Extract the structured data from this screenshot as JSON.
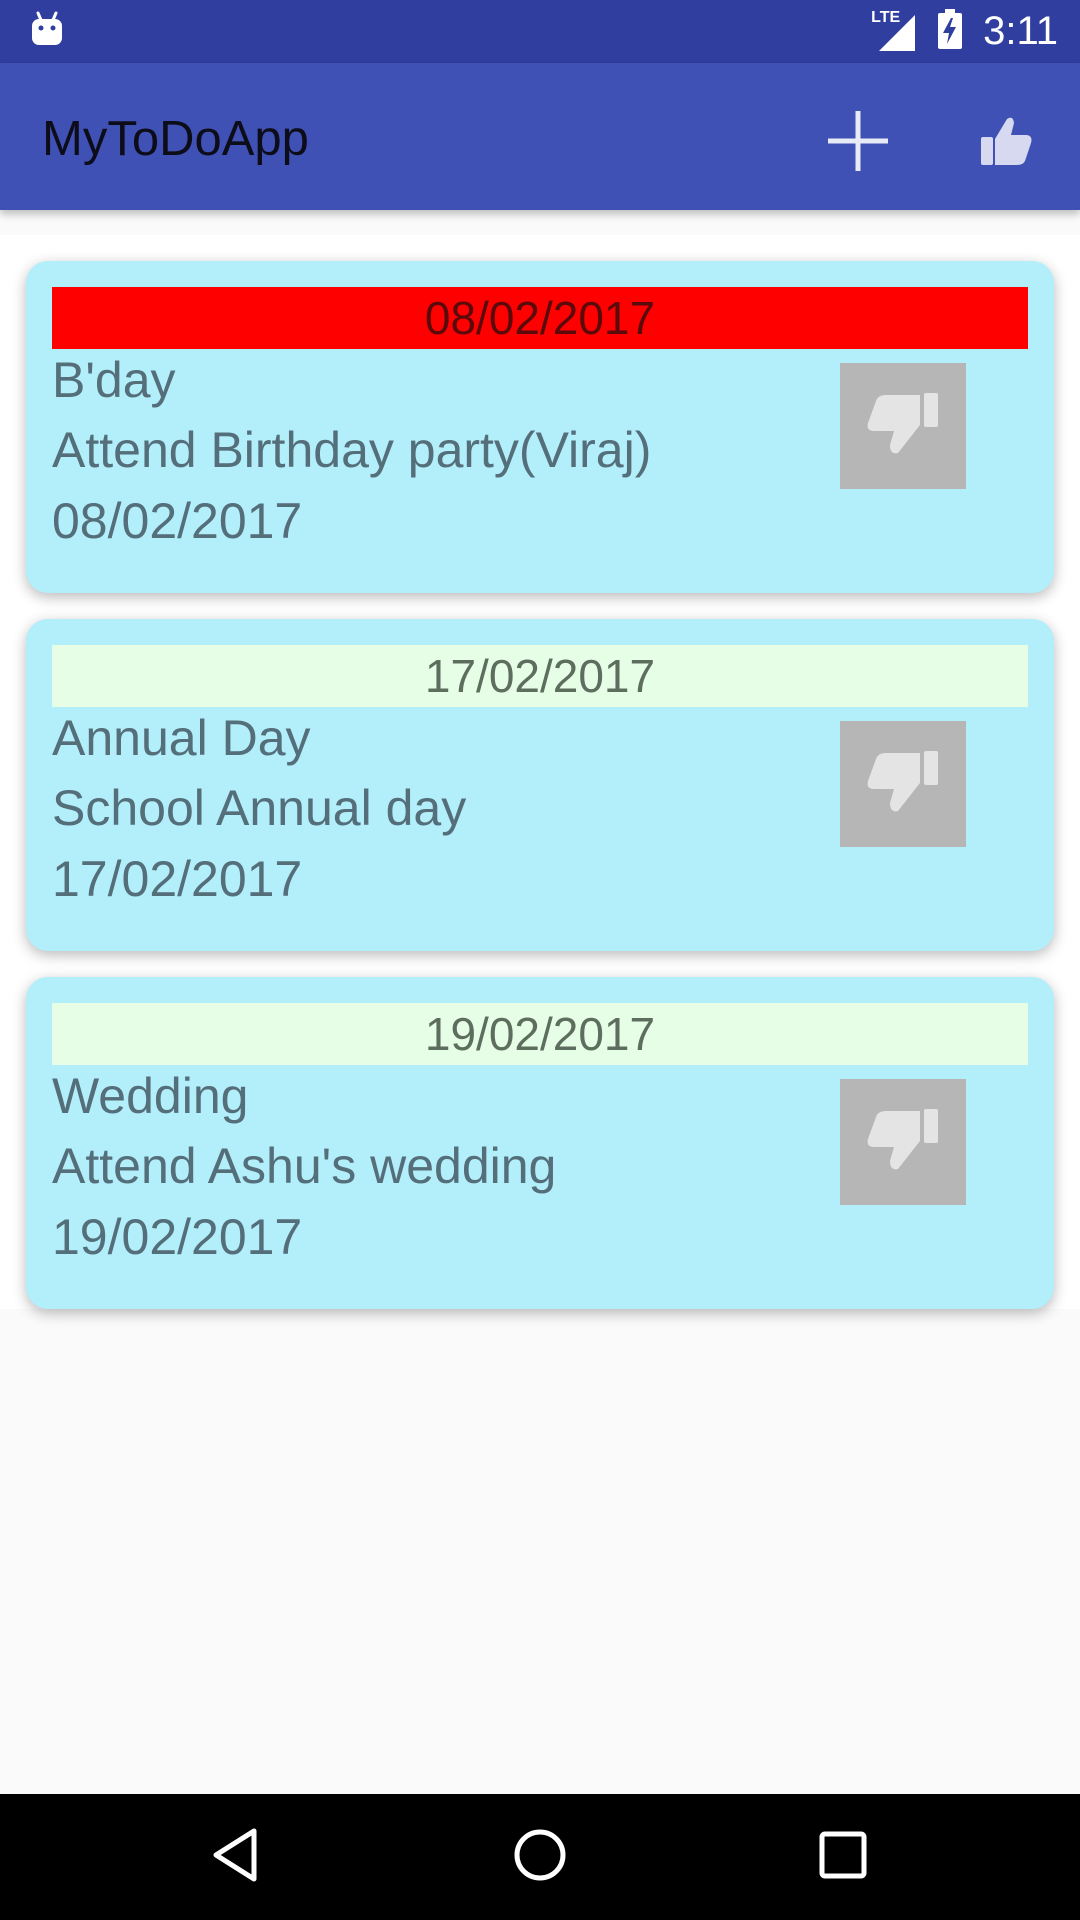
{
  "status_bar": {
    "network_label": "LTE",
    "time": "3:11",
    "icons": [
      "android-notification-icon",
      "lte-signal-icon",
      "battery-charging-icon"
    ]
  },
  "app_bar": {
    "title": "MyToDoApp",
    "actions": [
      {
        "icon": "add-icon"
      },
      {
        "icon": "thumbs-up-icon"
      }
    ]
  },
  "todos": [
    {
      "header_date": "08/02/2017",
      "title": "B'day",
      "description": "Attend Birthday party(Viraj)",
      "date": "08/02/2017",
      "status": "overdue",
      "header_color": "#ff0000",
      "icon": "thumbs-down-icon"
    },
    {
      "header_date": "17/02/2017",
      "title": "Annual Day",
      "description": "School Annual day",
      "date": "17/02/2017",
      "status": "upcoming",
      "header_color": "#e6fde6",
      "icon": "thumbs-down-icon"
    },
    {
      "header_date": "19/02/2017",
      "title": "Wedding",
      "description": "Attend Ashu's wedding",
      "date": "19/02/2017",
      "status": "upcoming",
      "header_color": "#e6fde6",
      "icon": "thumbs-down-icon"
    }
  ],
  "nav_bar": {
    "buttons": [
      "back-icon",
      "home-icon",
      "recents-icon"
    ]
  },
  "colors": {
    "status_bar": "#303f9f",
    "app_bar": "#3f51b5",
    "card": "#b3eefb"
  }
}
